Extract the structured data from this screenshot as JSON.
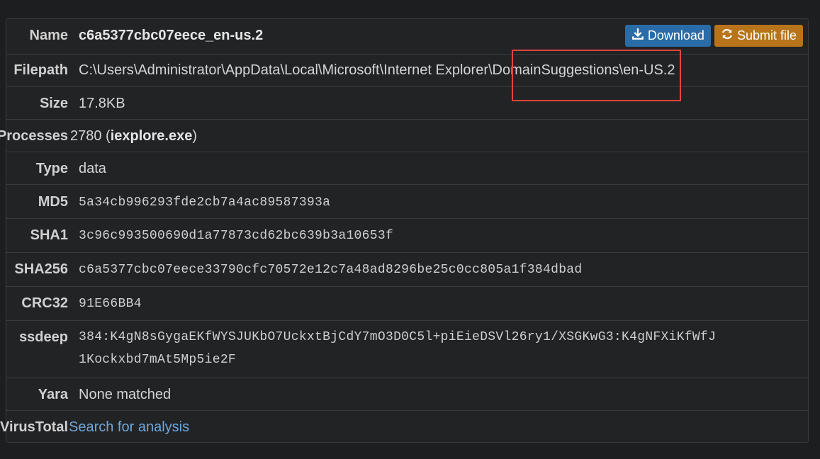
{
  "rows": {
    "name": {
      "label": "Name",
      "value": "c6a5377cbc07eece_en-us.2"
    },
    "filepath": {
      "label": "Filepath",
      "value": "C:\\Users\\Administrator\\AppData\\Local\\Microsoft\\Internet Explorer\\DomainSuggestions\\en-US.2"
    },
    "size": {
      "label": "Size",
      "value": "17.8KB"
    },
    "processes": {
      "label": "Processes",
      "pid": "2780 (",
      "proc": "iexplore.exe",
      "close": ")"
    },
    "type": {
      "label": "Type",
      "value": "data"
    },
    "md5": {
      "label": "MD5",
      "value": "5a34cb996293fde2cb7a4ac89587393a"
    },
    "sha1": {
      "label": "SHA1",
      "value": "3c96c993500690d1a77873cd62bc639b3a10653f"
    },
    "sha256": {
      "label": "SHA256",
      "value": "c6a5377cbc07eece33790cfc70572e12c7a48ad8296be25c0cc805a1f384dbad"
    },
    "crc32": {
      "label": "CRC32",
      "value": "91E66BB4"
    },
    "ssdeep": {
      "label": "ssdeep",
      "line1": "384:K4gN8sGygaEKfWYSJUKbO7UckxtBjCdY7mO3D0C5l+piEieDSVl26ry1/XSGKwG3:K4gNFXiKfWfJ",
      "line2": "1Kockxbd7mAt5Mp5ie2F"
    },
    "yara": {
      "label": "Yara",
      "value": "None matched"
    },
    "virustotal": {
      "label": "VirusTotal",
      "value": "Search for analysis"
    }
  },
  "buttons": {
    "download": "Download",
    "submit": "Submit file"
  },
  "icons": {
    "download": "download-icon",
    "submit": "refresh-icon"
  },
  "colors": {
    "download_bg": "#2a6ca8",
    "submit_bg": "#b8741a",
    "link": "#6fa8dc",
    "highlight": "#e0453f"
  }
}
